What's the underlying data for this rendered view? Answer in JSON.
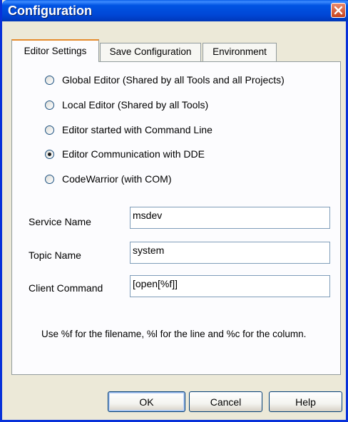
{
  "window": {
    "title": "Configuration"
  },
  "tabs": [
    {
      "label": "Editor Settings",
      "active": true
    },
    {
      "label": "Save Configuration",
      "active": false
    },
    {
      "label": "Environment",
      "active": false
    }
  ],
  "editor_options": [
    {
      "label": "Global Editor (Shared by all Tools and all Projects)",
      "selected": false
    },
    {
      "label": "Local Editor (Shared by all Tools)",
      "selected": false
    },
    {
      "label": "Editor started with Command Line",
      "selected": false
    },
    {
      "label": "Editor Communication with DDE",
      "selected": true
    },
    {
      "label": "CodeWarrior (with COM)",
      "selected": false
    }
  ],
  "fields": {
    "service_name": {
      "label": "Service Name",
      "value": "msdev"
    },
    "topic_name": {
      "label": "Topic Name",
      "value": "system"
    },
    "client_command": {
      "label": "Client Command",
      "value": "[open[%f]]"
    }
  },
  "hint": "Use %f for the filename, %l for the line and %c for the column.",
  "buttons": {
    "ok": "OK",
    "cancel": "Cancel",
    "help": "Help"
  },
  "colors": {
    "titlebar": "#0054e3",
    "dialog_bg": "#ece9d8",
    "panel_bg": "#fcfcfe",
    "close_button": "#c9441e",
    "active_tab_accent": "#e68b2c"
  }
}
